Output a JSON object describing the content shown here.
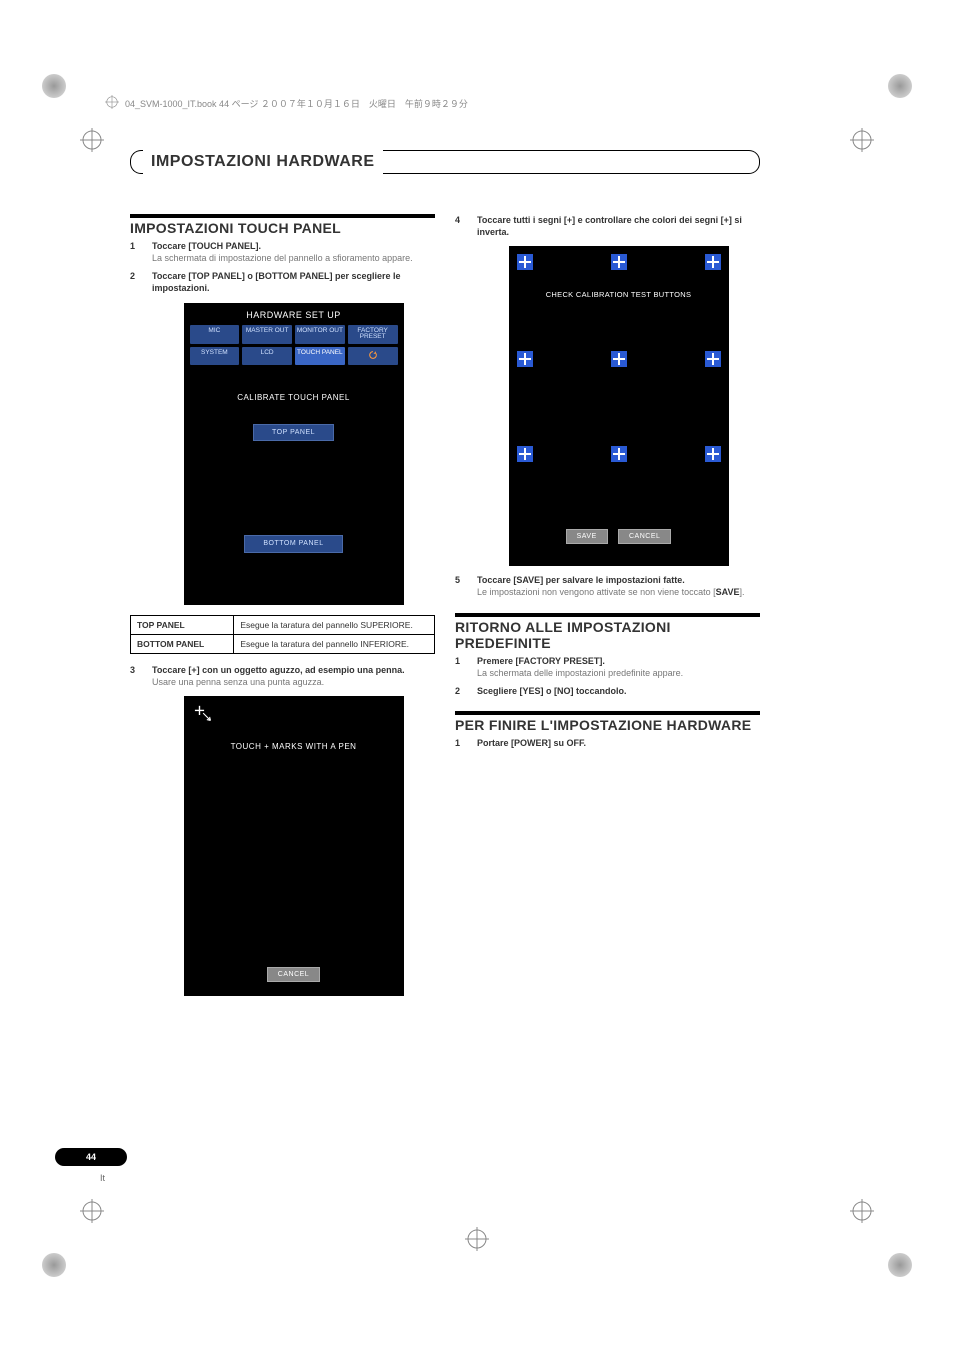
{
  "header_line": "04_SVM-1000_IT.book  44 ページ  ２００７年１０月１６日　火曜日　午前９時２９分",
  "section_title": "IMPOSTAZIONI HARDWARE",
  "page_number": "44",
  "page_lang": "It",
  "left": {
    "heading": "IMPOSTAZIONI TOUCH PANEL",
    "steps": [
      {
        "title": "Toccare [TOUCH PANEL].",
        "body": "La schermata di impostazione del pannello a sfioramento appare."
      },
      {
        "title": "Toccare [TOP PANEL] o [BOTTOM PANEL] per scegliere le impostazioni.",
        "body": ""
      },
      {
        "title": "Toccare [+] con un oggetto aguzzo, ad esempio una penna.",
        "body": "Usare una penna senza una punta aguzza."
      }
    ],
    "hw_setup": {
      "title": "HARDWARE SET UP",
      "tabs_row1": [
        "MIC",
        "MASTER OUT",
        "MONITOR OUT",
        "FACTORY PRESET"
      ],
      "tabs_row2": [
        "SYSTEM",
        "LCD",
        "TOUCH PANEL",
        "↺"
      ],
      "body_label": "CALIBRATE TOUCH PANEL",
      "btn_top": "TOP  PANEL",
      "btn_bottom": "BOTTOM  PANEL"
    },
    "table": {
      "rows": [
        {
          "k": "TOP PANEL",
          "v": "Esegue la taratura del pannello SUPERIORE."
        },
        {
          "k": "BOTTOM PANEL",
          "v": "Esegue la taratura del pannello INFERIORE."
        }
      ]
    },
    "touch_panel": {
      "msg": "TOUCH  +  MARKS WITH A PEN",
      "cancel": "CANCEL"
    }
  },
  "right": {
    "step4": {
      "title": "Toccare tutti i segni [+] e controllare che  colori dei segni [+] si inverta.",
      "body": ""
    },
    "calib": {
      "msg": "CHECK CALIBRATION TEST BUTTONS",
      "save": "SAVE",
      "cancel": "CANCEL"
    },
    "step5": {
      "title": "Toccare [SAVE] per salvare le impostazioni fatte.",
      "body_pre": "Le impostazioni non vengono attivate se non viene toccato [",
      "body_bold": "SAVE",
      "body_post": "]."
    },
    "heading2": "RITORNO ALLE IMPOSTAZIONI PREDEFINITE",
    "steps2": [
      {
        "title": "Premere [FACTORY PRESET].",
        "body": "La schermata delle impostazioni predefinite appare."
      },
      {
        "title": "Scegliere [YES] o [NO] toccandolo.",
        "body": ""
      }
    ],
    "heading3": "PER FINIRE L'IMPOSTAZIONE HARDWARE",
    "steps3": [
      {
        "title": "Portare [POWER] su OFF.",
        "body": ""
      }
    ]
  }
}
